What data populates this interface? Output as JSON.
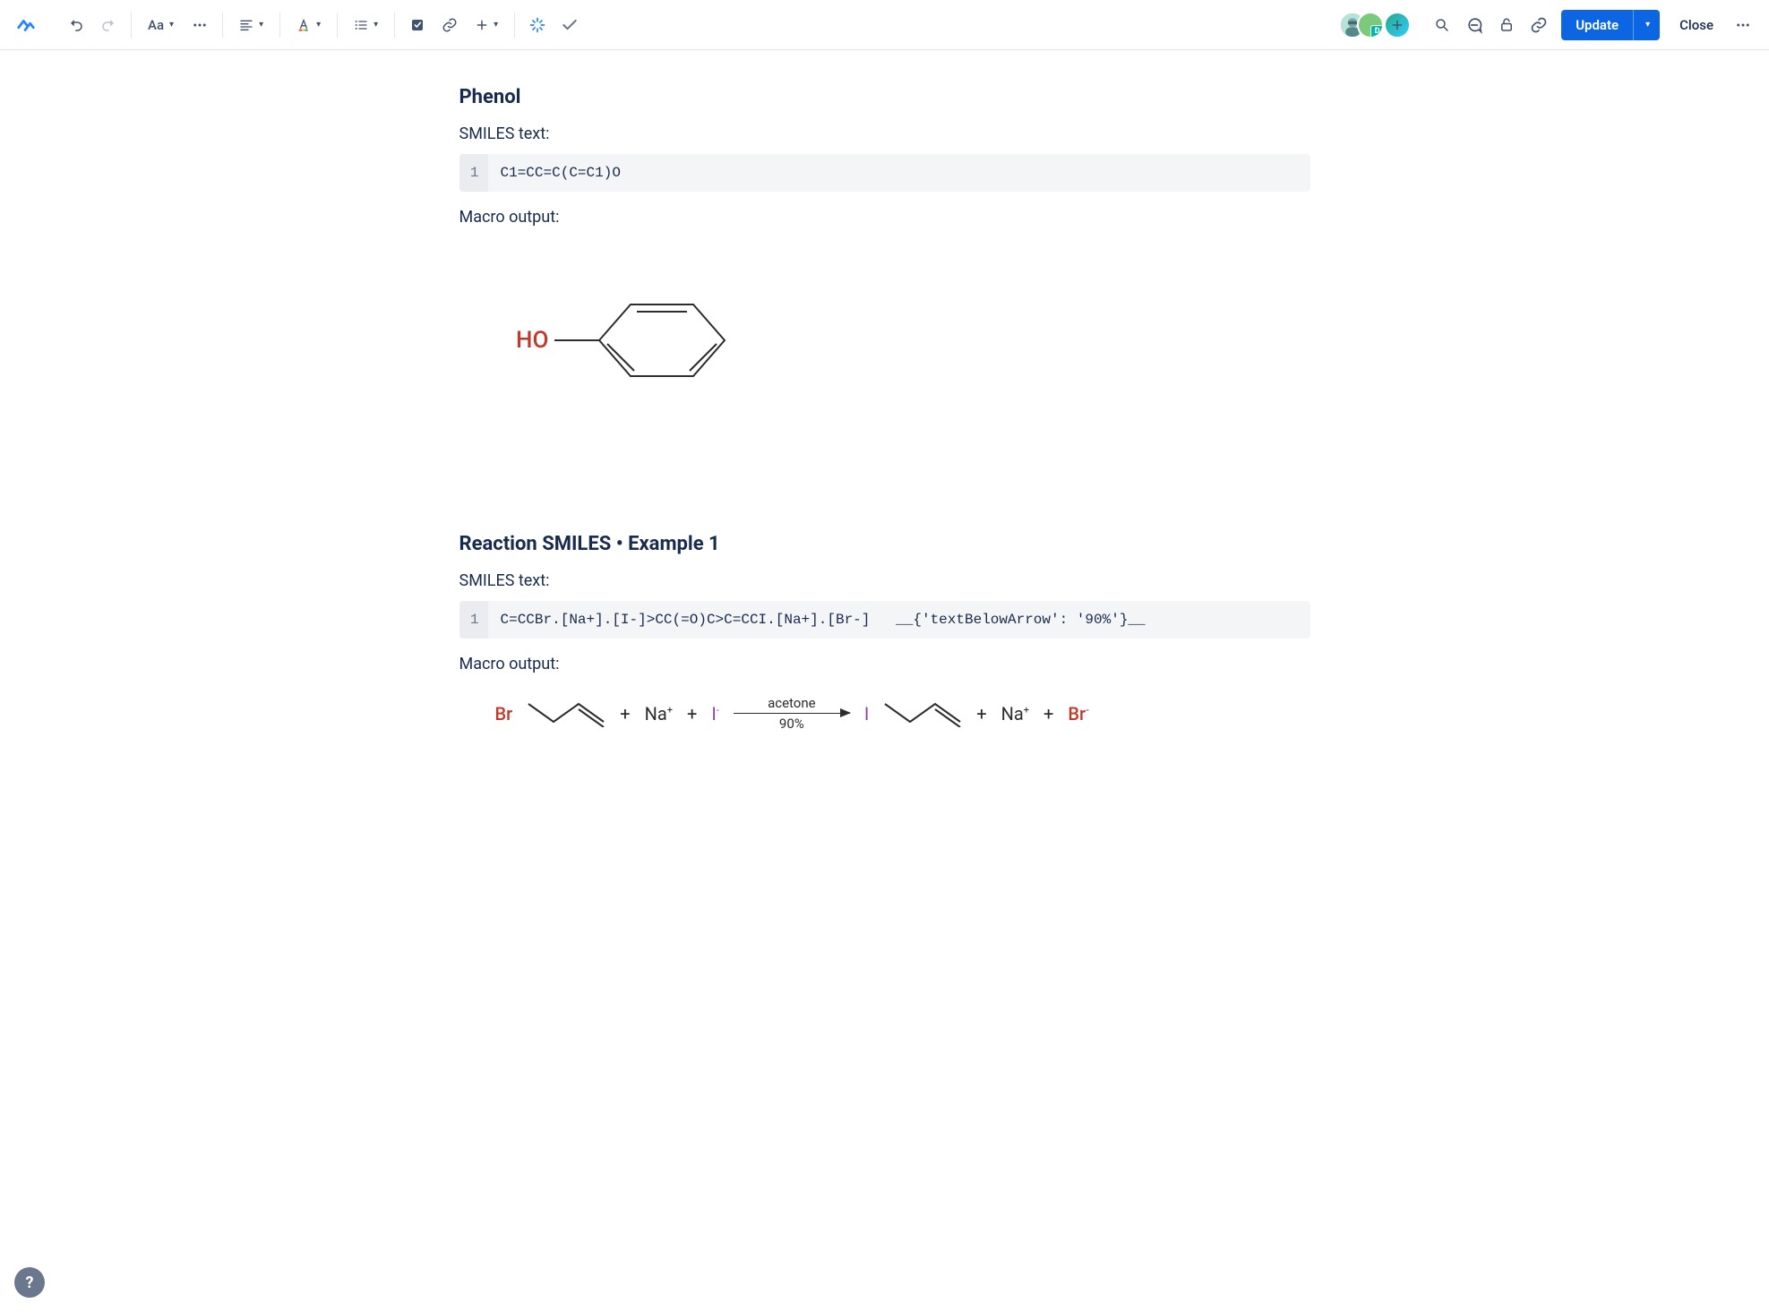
{
  "toolbar": {
    "text_styles_label": "Aa",
    "update_label": "Update",
    "close_label": "Close",
    "avatar_initial": "D"
  },
  "sections": [
    {
      "title": "Phenol",
      "smiles_label": "SMILES text:",
      "code_line_no": "1",
      "code": "C1=CC=C(C=C1)O",
      "output_label": "Macro output:",
      "molecule": {
        "label": "HO"
      }
    },
    {
      "title": "Reaction SMILES • Example 1",
      "smiles_label": "SMILES text:",
      "code_line_no": "1",
      "code": "C=CCBr.[Na+].[I-]>CC(=O)C>C=CCI.[Na+].[Br-]   __{'textBelowArrow': '90%'}__",
      "output_label": "Macro output:",
      "reaction": {
        "reagent_br": "Br",
        "plus": "+",
        "na": "Na",
        "na_sup": "+",
        "iodide": "I",
        "iodide_sup": "-",
        "arrow_above": "acetone",
        "arrow_below": "90%",
        "product_i": "I",
        "product_br": "Br",
        "product_br_sup": "-"
      }
    }
  ],
  "help": "?"
}
